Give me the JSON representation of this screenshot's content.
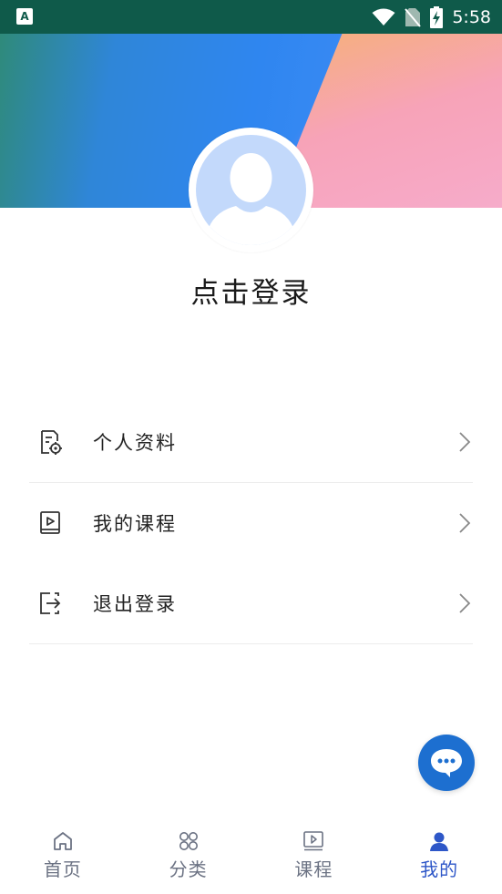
{
  "status_bar": {
    "app_icon_letter": "A",
    "time": "5:58"
  },
  "profile": {
    "login_prompt": "点击登录"
  },
  "menu": {
    "items": [
      {
        "label": "个人资料",
        "icon": "profile-settings-icon"
      },
      {
        "label": "我的课程",
        "icon": "course-play-icon"
      },
      {
        "label": "退出登录",
        "icon": "logout-icon"
      }
    ]
  },
  "bottom_nav": {
    "items": [
      {
        "label": "首页",
        "icon": "home-icon",
        "active": false
      },
      {
        "label": "分类",
        "icon": "category-icon",
        "active": false
      },
      {
        "label": "课程",
        "icon": "course-icon",
        "active": false
      },
      {
        "label": "我的",
        "icon": "user-icon",
        "active": true
      }
    ]
  },
  "colors": {
    "status_bar": "#0f5a4a",
    "accent": "#2e57c8",
    "fab": "#1d6fd0",
    "avatar_bg": "#c3d9fb"
  }
}
